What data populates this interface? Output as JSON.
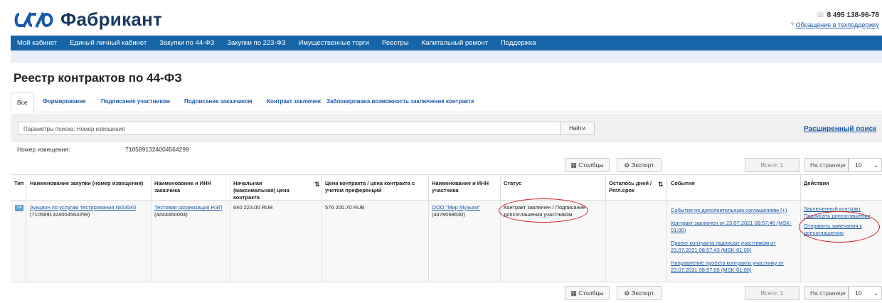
{
  "header": {
    "logo_text": "Фабрикант",
    "phone": "8 495 138-96-78",
    "support_link": "Обращение в техподдержку"
  },
  "nav": {
    "items": [
      "Мой кабинет",
      "Единый личный кабинет",
      "Закупки по 44-ФЗ",
      "Закупки по 223-ФЗ",
      "Имущественные торги",
      "Реестры",
      "Капитальный ремонт",
      "Поддержка"
    ]
  },
  "page_title": "Реестр контрактов по 44-ФЗ",
  "tabs": [
    "Все",
    "Формирование",
    "Подписание участником",
    "Подписание заказчиком",
    "Контракт заключен",
    "Заблокирована возможность заключения контракта"
  ],
  "search": {
    "placeholder": "Параметры поиска: Номер извещения",
    "button": "Найти",
    "advanced": "Расширенный поиск"
  },
  "filter": {
    "label": "Номер извещения:",
    "value": "7105891324004564299"
  },
  "toolbar": {
    "columns": "Столбцы",
    "export": "Экспорт",
    "total": "Всего: 1",
    "per_page_label": "На странице",
    "per_page_value": "10"
  },
  "table": {
    "headers": [
      "Тип",
      "Наименование закупки (номер извещения)",
      "Наименование и ИНН заказчика",
      "Начальная (максимальная) цена контракта",
      "Цена контракта / цена контракта с учетом преференций",
      "Наименование и ИНН участника",
      "Статус",
      "Осталось дней / Регл.срок",
      "События",
      "Действия"
    ],
    "row": {
      "type_badge": "ЭА",
      "purchase_link": "Аукцион по услугам тестирования №53540",
      "purchase_number": "(7105891324004564299)",
      "customer_link": "Тестовая организация НЭП",
      "customer_inn": "(4444460004)",
      "initial_price": "640 223.00 RUB",
      "contract_price": "576 200.70 RUB",
      "participant_link": "ООО \"Мир Музыки\"",
      "participant_inn": "(4478068630)",
      "status": "Контракт заключен / Подписание допсоглашения участником",
      "events": [
        "События по дополнительным соглашениям (+)",
        "Контракт заключен от 23.07.2021 08:57:46 (MSK-01:00)",
        "Проект контракта подписан участником от 23.07.2021 08:57:43 (MSK-01:00)",
        "Направление проекта контракта участнику от 23.07.2021 08:57:05 (MSK-01:00)"
      ],
      "actions": [
        "Заключенный контракт",
        "Подписать допсоглашение",
        "Отправить замечания к допсоглашению"
      ]
    }
  },
  "colors": {
    "nav_bg": "#1565a7",
    "link": "#1a5aa8",
    "highlight": "#d32020",
    "logo": "#17385f"
  }
}
